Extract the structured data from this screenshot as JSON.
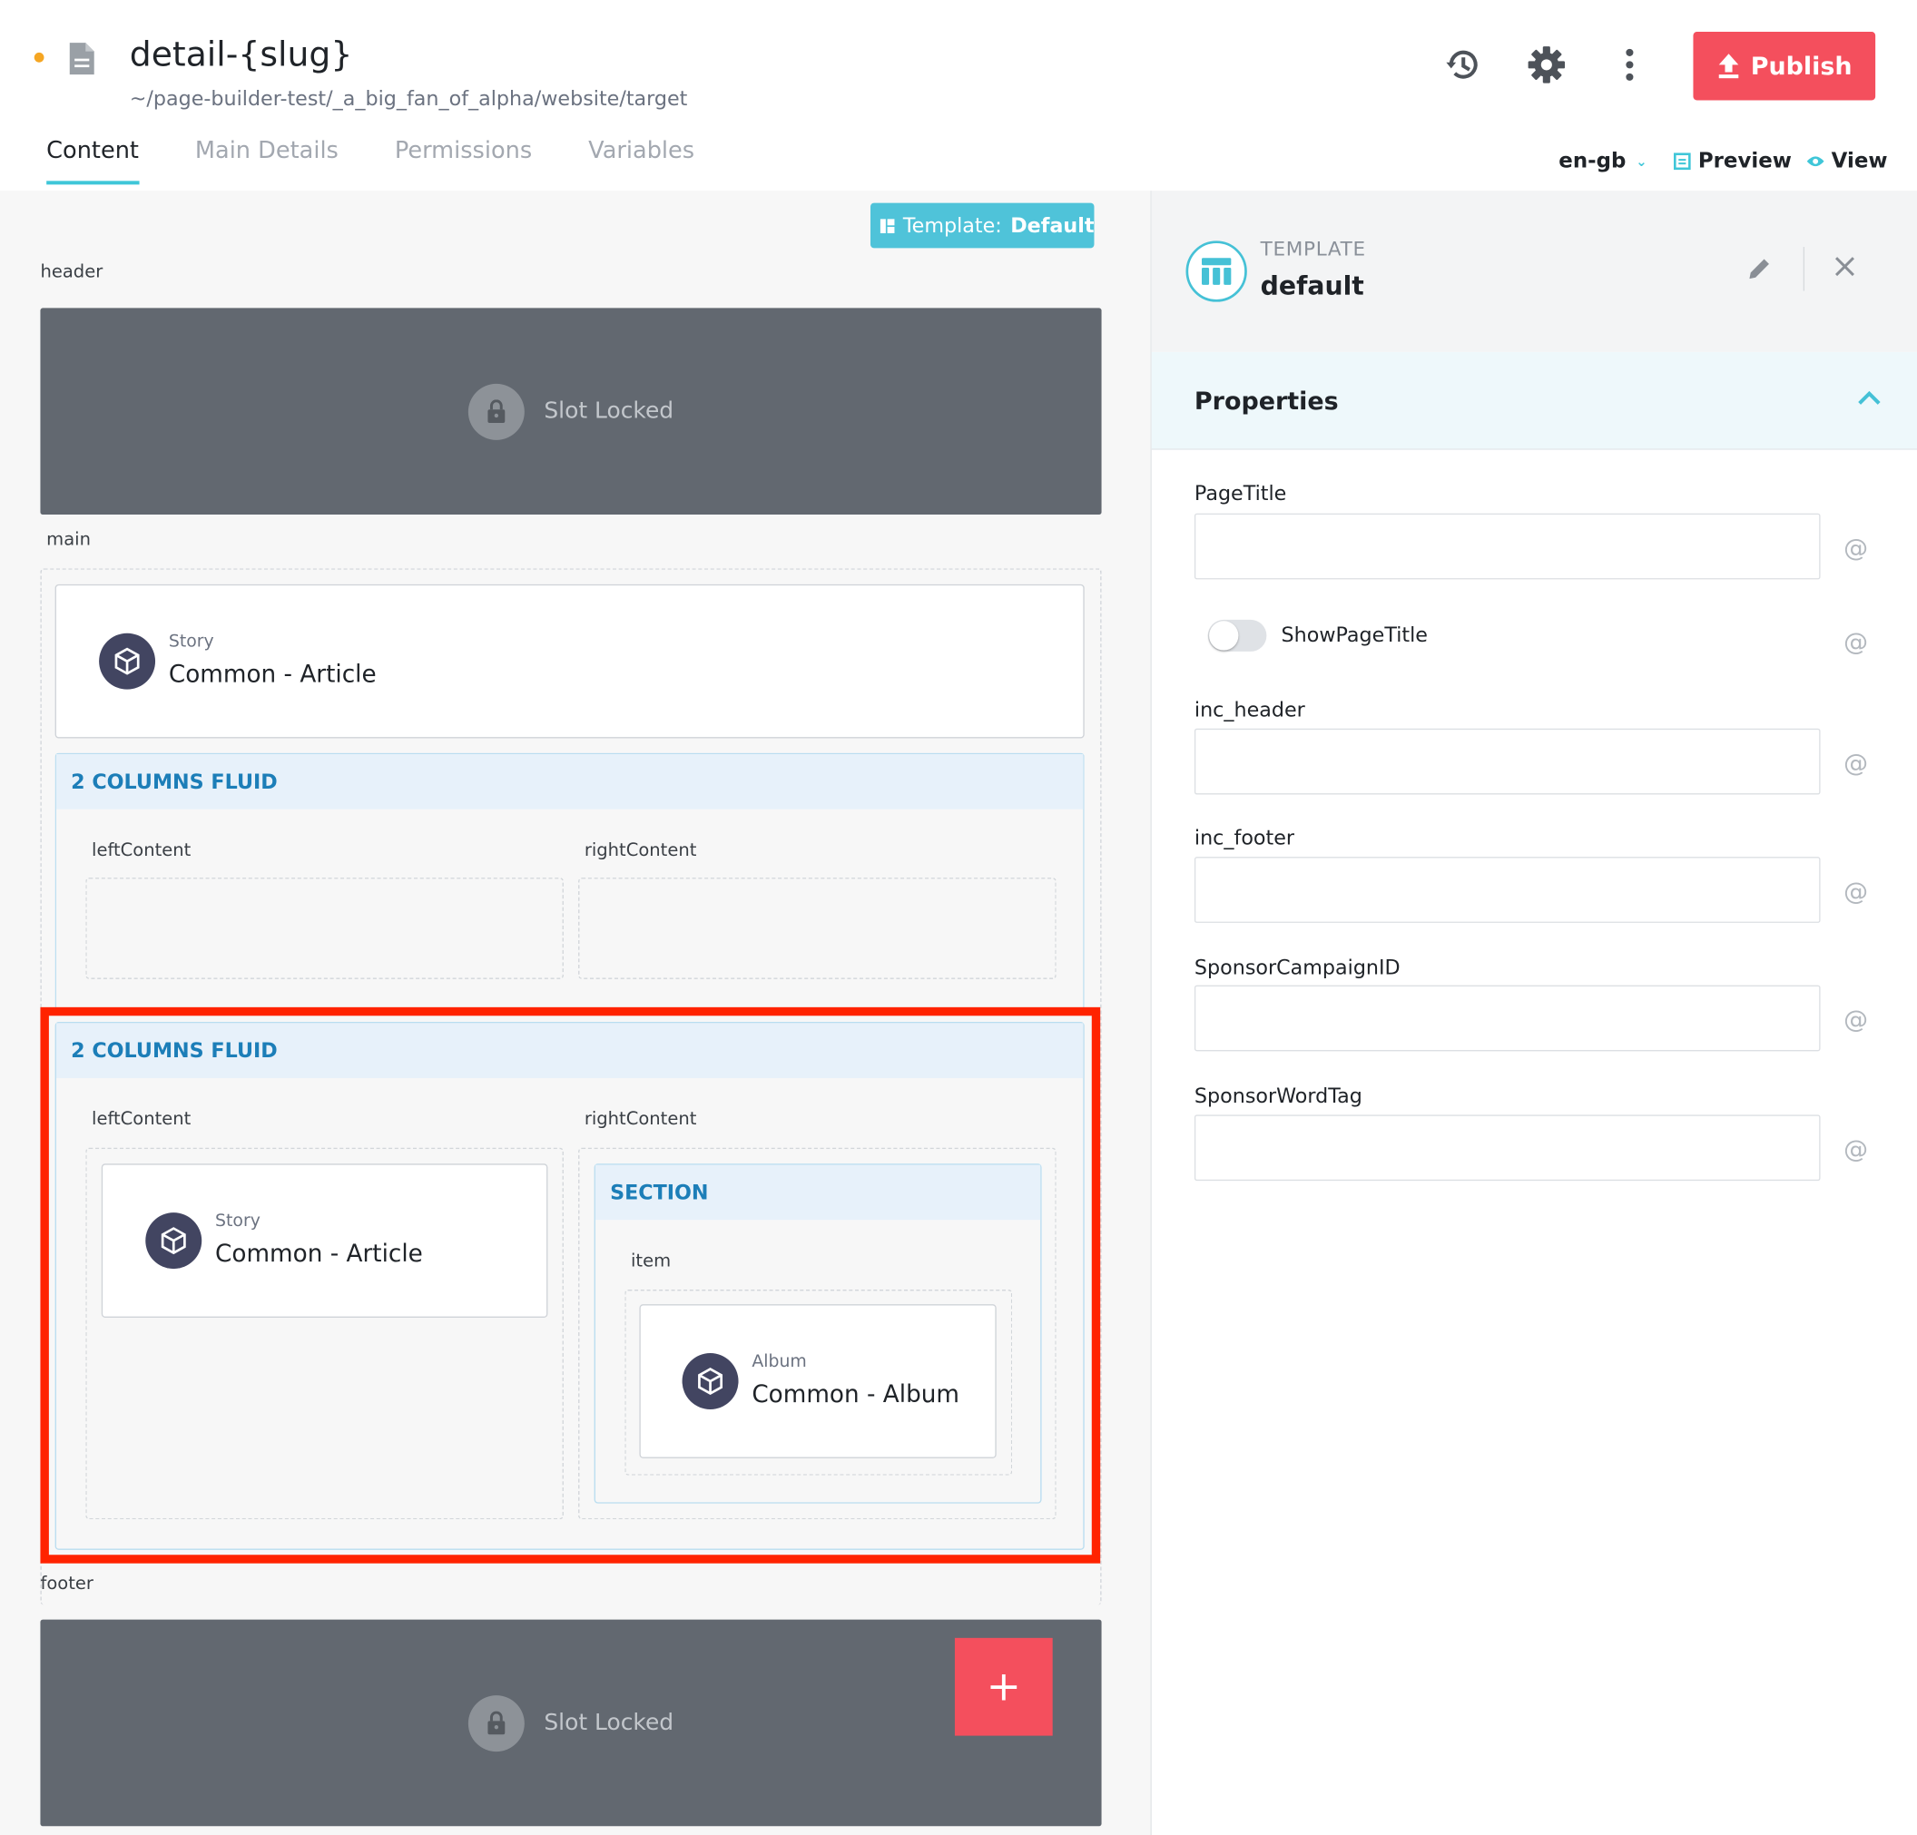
{
  "page": {
    "title": "detail-{slug}",
    "path": "~/page-builder-test/_a_big_fan_of_alpha/website/target",
    "status_color": "#f5a623"
  },
  "toolbar": {
    "history_icon": "history-icon",
    "settings_icon": "gear-icon",
    "more_icon": "more-vertical-icon",
    "publish_label": "Publish",
    "publish_color": "#f44f5d"
  },
  "tabs": [
    {
      "label": "Content",
      "active": true
    },
    {
      "label": "Main Details",
      "active": false
    },
    {
      "label": "Permissions",
      "active": false
    },
    {
      "label": "Variables",
      "active": false
    }
  ],
  "locale": {
    "value": "en-gb"
  },
  "actions": {
    "preview_label": "Preview",
    "view_label": "View"
  },
  "canvas": {
    "template_badge_prefix": "Template:",
    "template_badge_value": "Default",
    "header_label": "header",
    "main_label": "main",
    "footer_label": "footer",
    "locked_text": "Slot Locked",
    "add_label": "+",
    "story_card": {
      "type": "Story",
      "name": "Common - Article"
    },
    "layout1": {
      "title": "2 COLUMNS FLUID",
      "left_label": "leftContent",
      "right_label": "rightContent"
    },
    "layout2": {
      "title": "2 COLUMNS FLUID",
      "left_label": "leftContent",
      "right_label": "rightContent",
      "left_card": {
        "type": "Story",
        "name": "Common - Article"
      },
      "section": {
        "title": "SECTION",
        "item_label": "item",
        "card": {
          "type": "Album",
          "name": "Common - Album"
        }
      }
    },
    "highlight_color": "#ff2300"
  },
  "panel": {
    "kicker": "TEMPLATE",
    "title": "default",
    "properties_label": "Properties",
    "fields": {
      "page_title": {
        "label": "PageTitle",
        "value": ""
      },
      "show_page_title": {
        "label": "ShowPageTitle",
        "on": false
      },
      "inc_header": {
        "label": "inc_header",
        "value": ""
      },
      "inc_footer": {
        "label": "inc_footer",
        "value": ""
      },
      "sponsor_campaign_id": {
        "label": "SponsorCampaignID",
        "value": ""
      },
      "sponsor_word_tag": {
        "label": "SponsorWordTag",
        "value": ""
      }
    },
    "at_symbol": "@",
    "accent_color": "#45c1d6"
  }
}
